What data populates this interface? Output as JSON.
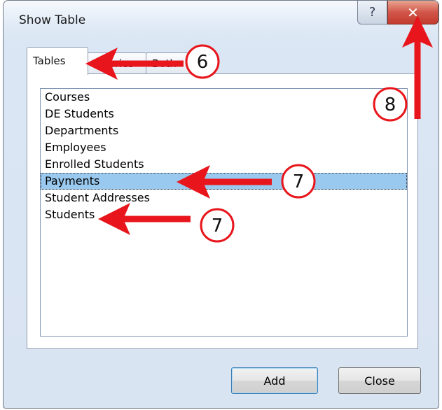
{
  "window": {
    "title": "Show Table",
    "help_glyph": "?",
    "close_glyph": "✕"
  },
  "tabs": [
    {
      "label": "Tables"
    },
    {
      "label": "Queries"
    },
    {
      "label": "Both"
    }
  ],
  "tables_list": {
    "items": [
      "Courses",
      "DE Students",
      "Departments",
      "Employees",
      "Enrolled Students",
      "Payments",
      "Student Addresses",
      "Students"
    ],
    "selected": "Payments"
  },
  "buttons": {
    "add": "Add",
    "close": "Close"
  },
  "callouts": {
    "tabs": "6",
    "payments": "7",
    "students": "7",
    "close": "8"
  },
  "colors": {
    "arrow": "#e8161c",
    "selection": "#99c9ef",
    "close_button": "#c9493d"
  }
}
